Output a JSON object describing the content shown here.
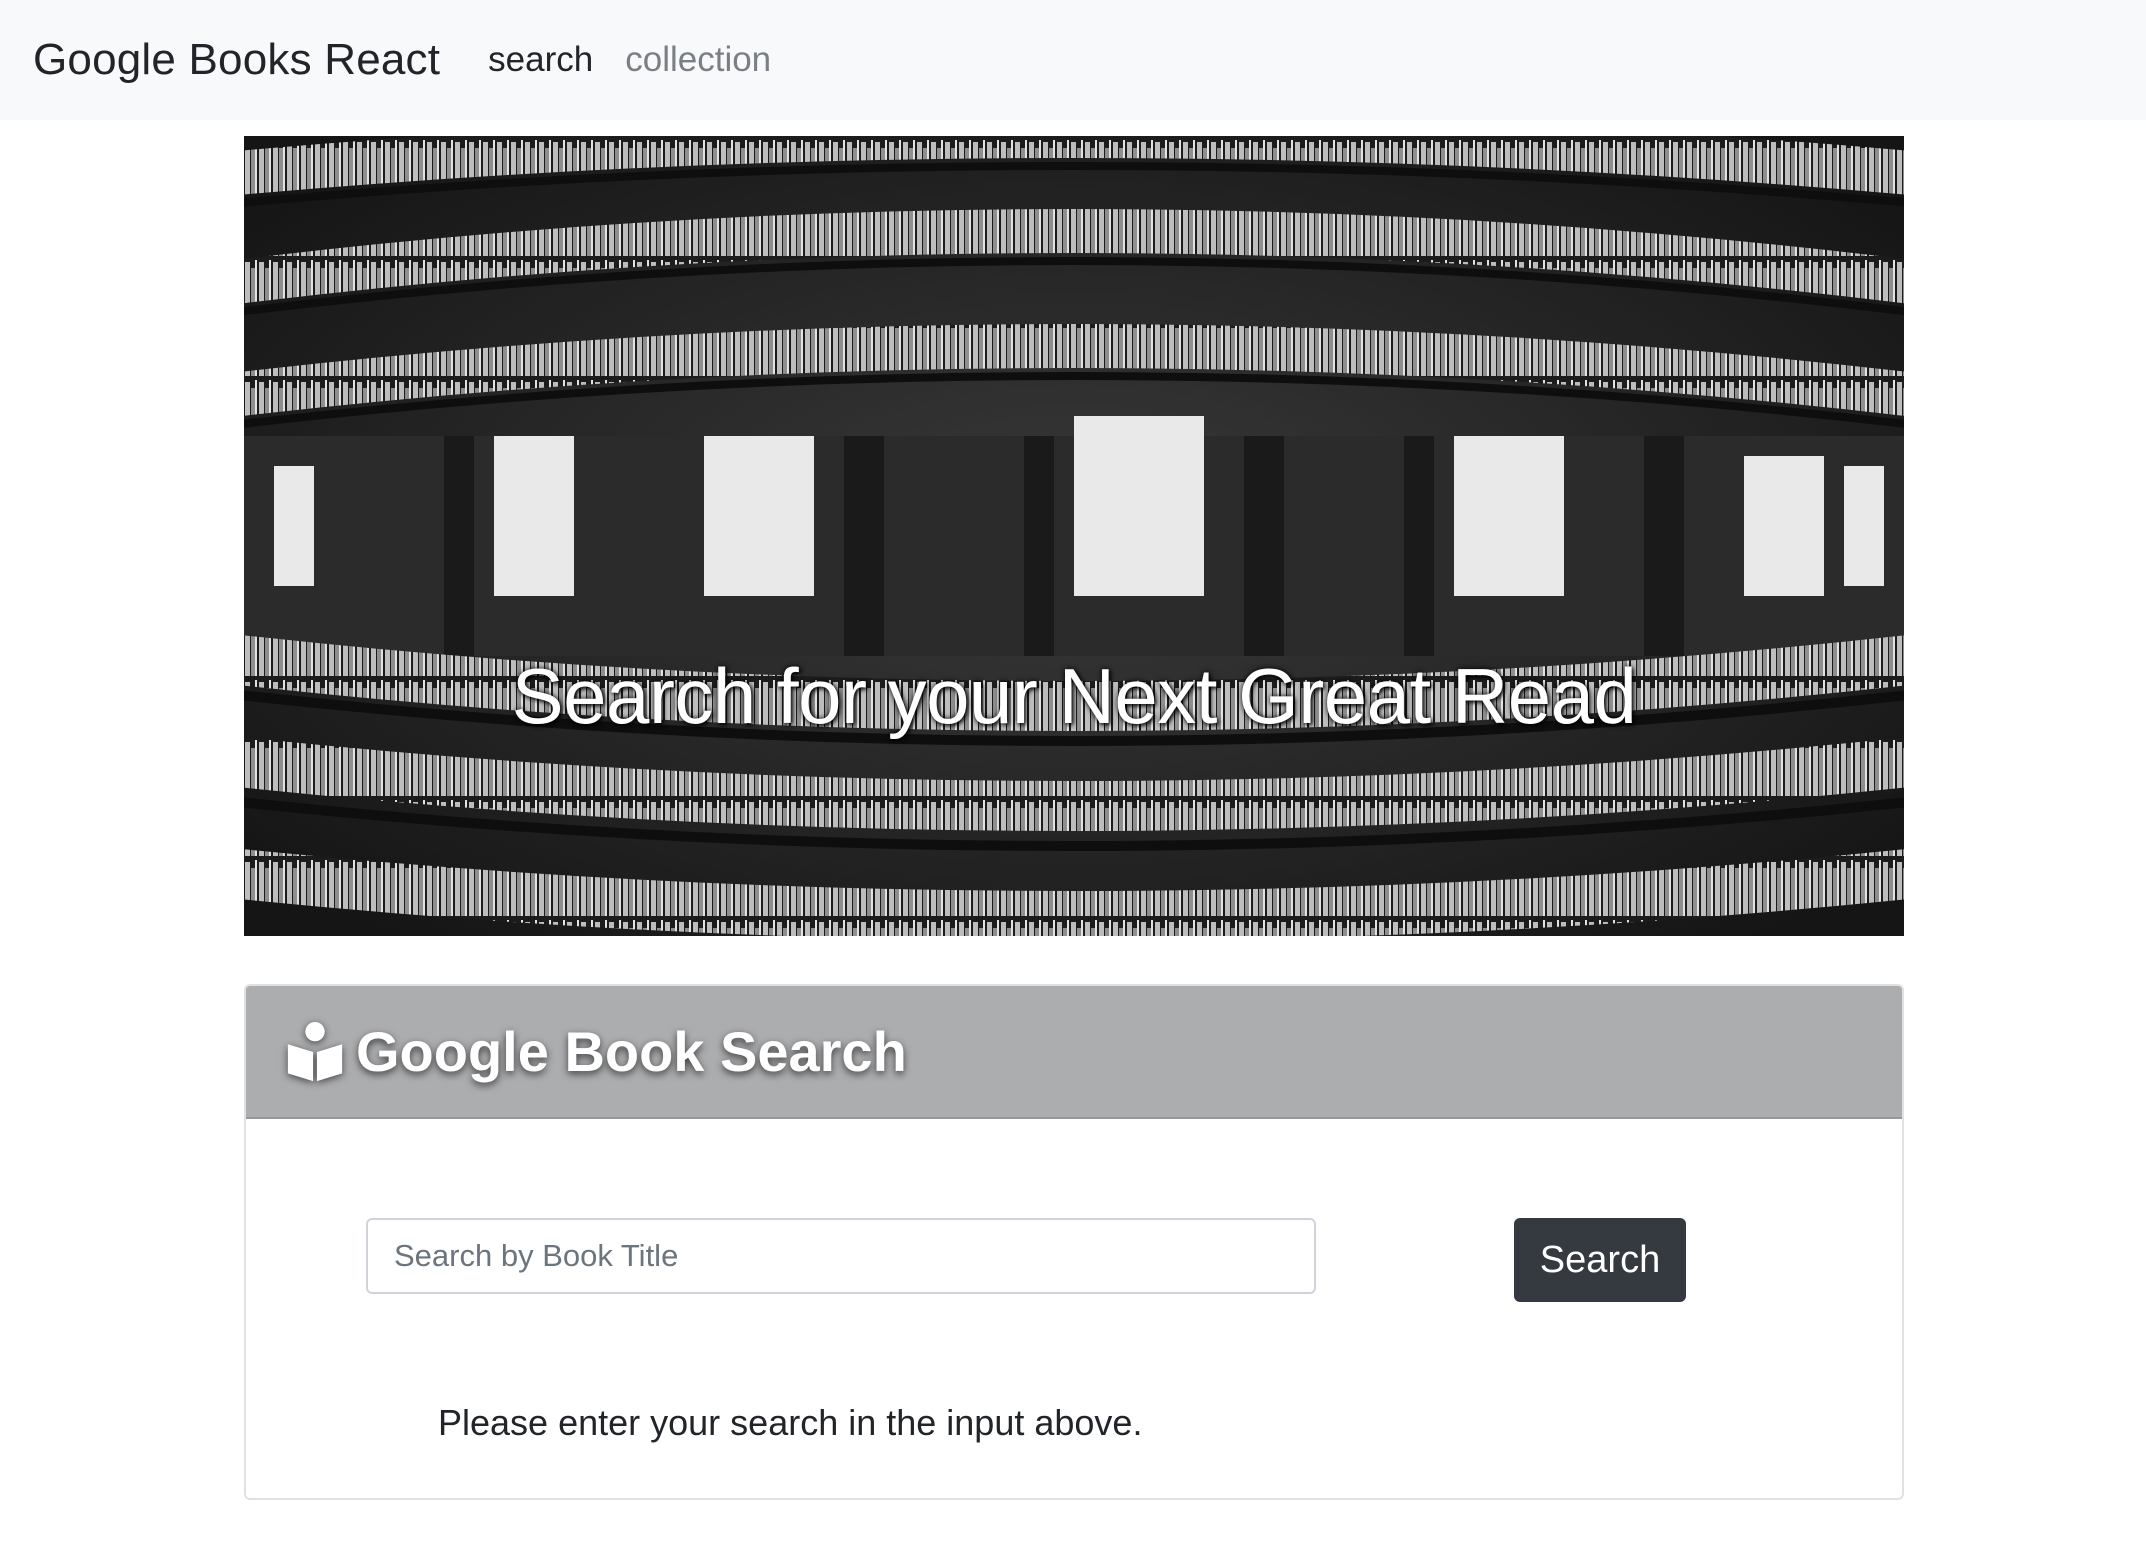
{
  "navbar": {
    "brand": "Google Books React",
    "links": [
      {
        "label": "search",
        "active": true
      },
      {
        "label": "collection",
        "active": false
      }
    ]
  },
  "hero": {
    "title": "Search for your Next Great Read",
    "image_description": "black-and-white fisheye photo of library bookshelves"
  },
  "search_card": {
    "icon": "book-reader-icon",
    "title": "Google Book Search",
    "input_placeholder": "Search by Book Title",
    "input_value": "",
    "button_label": "Search",
    "message": "Please enter your search in the input above."
  },
  "colors": {
    "navbar_bg": "#f8f9fa",
    "card_header_bg": "#acadaf",
    "button_bg": "#343a40"
  }
}
